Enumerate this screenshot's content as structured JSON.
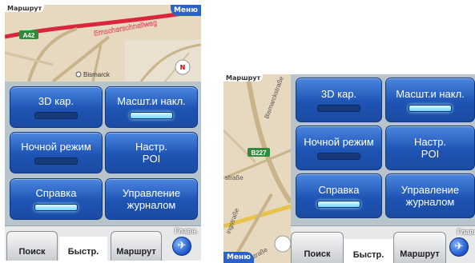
{
  "screen1": {
    "route_label": "Маршрут",
    "menu_label": "Меню",
    "map_labels": {
      "road_id": "A42",
      "street": "Emscherschnellweg",
      "place": "Bismarck",
      "north": "N"
    },
    "tiles": [
      {
        "label": "3D кар.",
        "indicator": "off"
      },
      {
        "label": "Масшт.и накл.",
        "indicator": "on"
      },
      {
        "label": "Ночной режим",
        "indicator": "off"
      },
      {
        "label": "Настр.\nPOI",
        "indicator": null
      },
      {
        "label": "Справка",
        "indicator": "on"
      },
      {
        "label": "Управление\nжурналом",
        "indicator": null
      }
    ],
    "tabs": {
      "search": "Поиск",
      "quick": "Быстр.",
      "route": "Маршрут",
      "home_caption": "Главн.",
      "home_icon": "globe-icon"
    }
  },
  "screen2": {
    "route_label": "Маршрут",
    "menu_label": "Меню",
    "map_labels": {
      "road_id": "B227",
      "street1": "Bismarckstraße",
      "street2": "straße",
      "street3": "ingstraße",
      "street4": "straße"
    },
    "tiles": [
      {
        "label": "3D кар.",
        "indicator": "off"
      },
      {
        "label": "Масшт.и накл.",
        "indicator": "on"
      },
      {
        "label": "Ночной режим",
        "indicator": "off"
      },
      {
        "label": "Настр.\nPOI",
        "indicator": null
      },
      {
        "label": "Справка",
        "indicator": "on"
      },
      {
        "label": "Управление\nжурналом",
        "indicator": null
      }
    ],
    "tabs": {
      "search": "Поиск",
      "quick": "Быстр.",
      "route": "Маршрут",
      "home_caption": "Главн",
      "home_icon": "globe-icon"
    }
  },
  "colors": {
    "tile_blue": "#1e54b4",
    "indicator_on": "#6fd8ff",
    "menu_blue": "#2a62c9",
    "route_red": "#d8263a",
    "map_bg": "#e8dcc4"
  }
}
